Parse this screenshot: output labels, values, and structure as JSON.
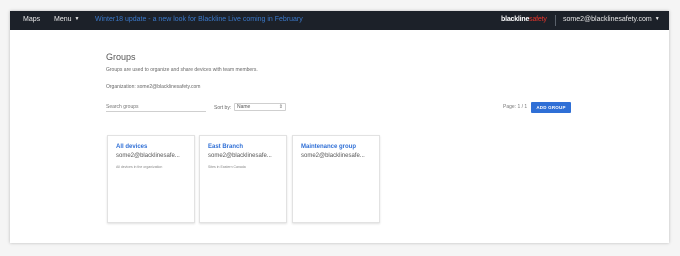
{
  "nav": {
    "maps_label": "Maps",
    "menu_label": "Menu",
    "banner_text": "Winter18 update - a new look for Blackline Live coming in February",
    "logo_main": "blackline",
    "logo_accent": "safety",
    "user_email": "some2@blacklinesafety.com"
  },
  "groups_page": {
    "title": "Groups",
    "subtitle": "Groups are used to organize and share devices with team members.",
    "organization": "Organization: some2@blacklinesafety.com",
    "search_placeholder": "Search groups",
    "sort_label": "Sort by:",
    "sort_value": "Name",
    "pagination": "Page: 1 / 1",
    "add_button": "ADD GROUP"
  },
  "cards": [
    {
      "name": "All devices",
      "email": "some2@blacklinesafe...",
      "description": "All devices in the organization"
    },
    {
      "name": "East Branch",
      "email": "some2@blacklinesafe...",
      "description": "Sites in Eastern Canada"
    },
    {
      "name": "Maintenance group",
      "email": "some2@blacklinesafe...",
      "description": ""
    }
  ],
  "colors": {
    "topbar": "#1c2129",
    "banner": "#3a78c9",
    "accent": "#2f6fd6",
    "logo_accent": "#e5342b"
  }
}
